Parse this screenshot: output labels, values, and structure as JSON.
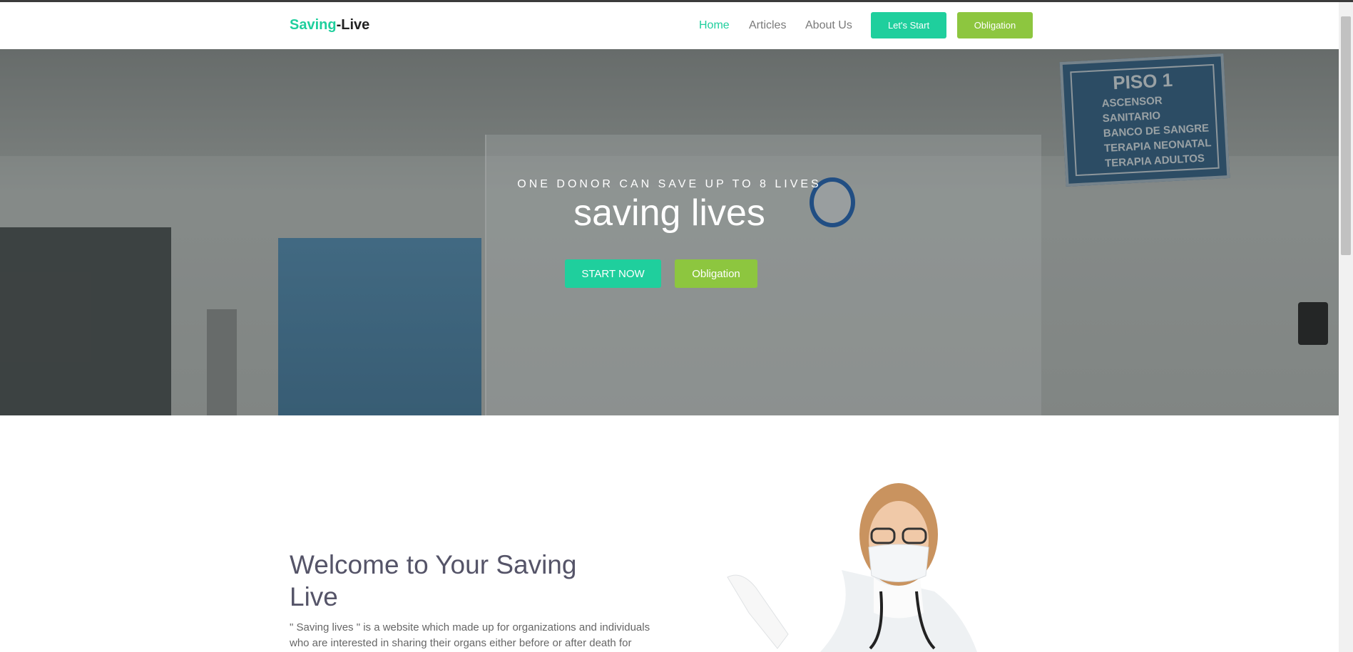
{
  "brand": {
    "part1": "Saving",
    "part2": "-Live"
  },
  "nav": {
    "links": [
      "Home",
      "Articles",
      "About Us"
    ],
    "start_button": "Let's Start",
    "obligation_button": "Obligation"
  },
  "hero": {
    "eyebrow": "ONE DONOR CAN SAVE UP TO 8 LIVES",
    "title": "saving lives",
    "start_button": "START NOW",
    "obligation_button": "Obligation",
    "sign": {
      "heading": "PISO 1",
      "lines": [
        "ASCENSOR",
        "SANITARIO",
        "BANCO DE SANGRE",
        "TERAPIA NEONATAL",
        "TERAPIA ADULTOS"
      ]
    }
  },
  "welcome": {
    "title": "Welcome to Your Saving Live",
    "text": "\" Saving lives \" is a website which made up for organizations and individuals who are interested in sharing their organs either before or after death for"
  },
  "colors": {
    "accent": "#1fcf9d",
    "secondary": "#8dc63f",
    "heading": "#555468"
  }
}
